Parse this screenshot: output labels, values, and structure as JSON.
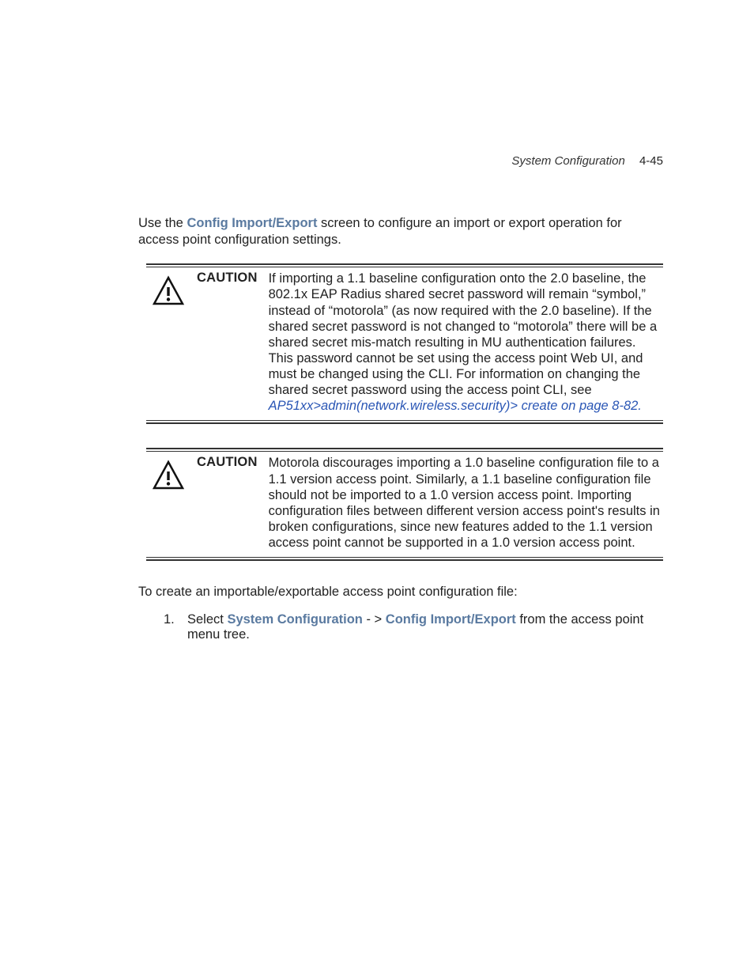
{
  "header": {
    "section": "System Configuration",
    "page": "4-45"
  },
  "intro": {
    "pre": "Use the ",
    "bold": "Config Import/Export",
    "post": " screen to configure an import or export operation for access point configuration settings."
  },
  "caution1": {
    "label": "CAUTION",
    "text": "If importing a 1.1 baseline configuration onto the 2.0 baseline, the 802.1x EAP Radius shared secret password will remain “symbol,” instead of “motorola” (as now required with the 2.0 baseline). If the shared secret password is not changed to “motorola” there will be a shared secret mis-match resulting in MU authentication failures. This password cannot be set using the access point Web UI, and must be changed using the CLI. For information on changing the shared secret password using the access point CLI, see ",
    "link": "AP51xx>admin(network.wireless.security)> create on page 8-82."
  },
  "caution2": {
    "label": "CAUTION",
    "text": "Motorola discourages importing a 1.0 baseline configuration file to a 1.1 version access point. Similarly, a 1.1 baseline configuration file should not be imported to a 1.0 version access point. Importing configuration files between different version access point's results in broken configurations, since new features added to the 1.1 version access point cannot be supported in a 1.0 version access point."
  },
  "toCreate": "To create an importable/exportable access point configuration file:",
  "step1": {
    "num": "1.",
    "pre": "Select ",
    "bold1": "System Configuration",
    "mid": " - > ",
    "bold2": "Config Import/Export",
    "post": " from the access point menu tree."
  }
}
